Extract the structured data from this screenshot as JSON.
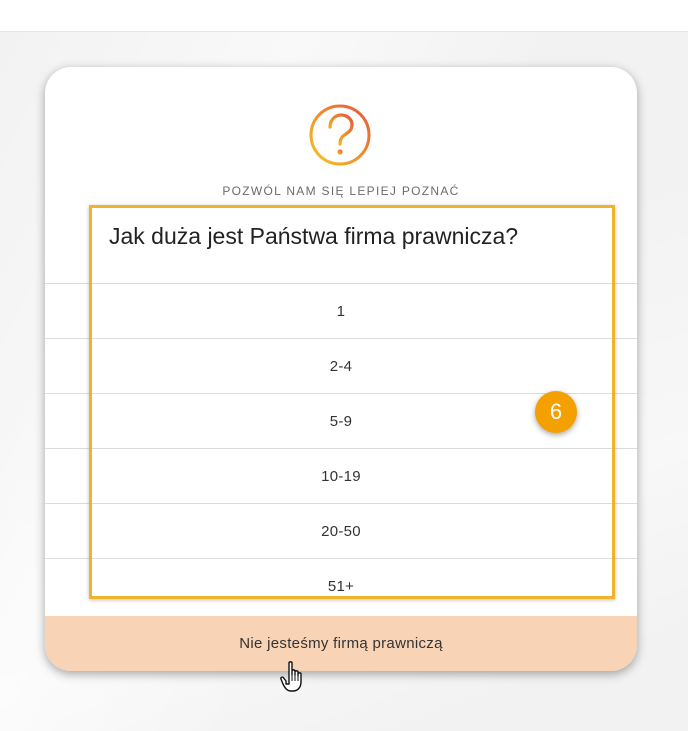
{
  "dialog": {
    "icon": "question-circle-icon",
    "subtitle": "POZWÓL NAM SIĘ LEPIEJ POZNAĆ",
    "question": "Jak duża jest Państwa firma prawnicza?",
    "options": [
      {
        "label": "1"
      },
      {
        "label": "2-4"
      },
      {
        "label": "5-9"
      },
      {
        "label": "10-19"
      },
      {
        "label": "20-50"
      },
      {
        "label": "51+"
      }
    ],
    "footer_button": "Nie jesteśmy firmą prawniczą"
  },
  "annotation": {
    "step_number": "6",
    "highlight_color": "#f0b429",
    "badge_color": "#f3a000"
  },
  "colors": {
    "footer_background": "#f8d3b6",
    "icon_gradient_start": "#f7c51e",
    "icon_gradient_end": "#e8563a"
  },
  "cursor": {
    "icon": "hand-pointer-icon"
  }
}
